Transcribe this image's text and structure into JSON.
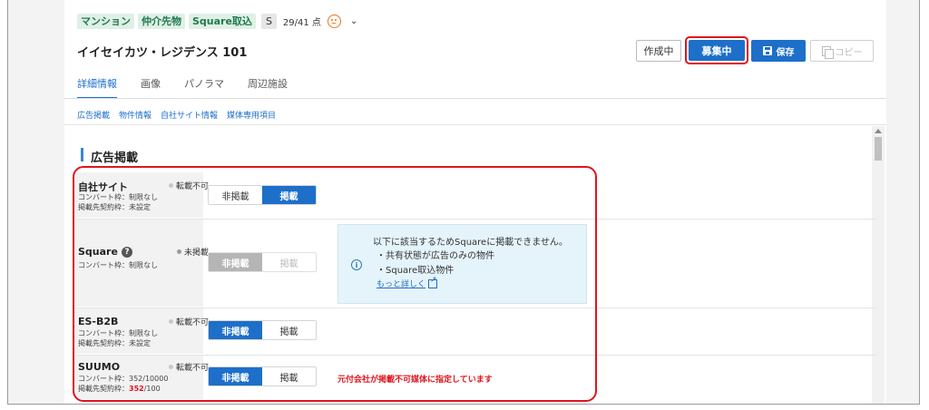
{
  "header": {
    "tags": [
      "マンション",
      "仲介先物",
      "Square取込"
    ],
    "tag_s": "S",
    "score": "29/41 点",
    "title": "イイセイカツ・レジデンス 101"
  },
  "actions": {
    "draft": "作成中",
    "recruiting": "募集中",
    "save": "保存",
    "copy": "コピー"
  },
  "tabs": [
    "詳細情報",
    "画像",
    "パノラマ",
    "周辺施設"
  ],
  "subnav": [
    "広告掲載",
    "物件情報",
    "自社サイト情報",
    "媒体専用項目"
  ],
  "section": {
    "title": "広告掲載"
  },
  "media": [
    {
      "name": "自社サイト",
      "status": "転載不可",
      "line1": "コンバート枠：制限なし",
      "line2": "掲載先契約枠：未設定",
      "off": "非掲載",
      "on": "掲載"
    },
    {
      "name": "Square",
      "status": "未掲載",
      "line1": "コンバート枠：制限なし",
      "off": "非掲載",
      "on": "掲載"
    },
    {
      "name": "ES-B2B",
      "status": "転載不可",
      "line1": "コンバート枠：制限なし",
      "line2": "掲載先契約枠：未設定",
      "off": "非掲載",
      "on": "掲載"
    },
    {
      "name": "SUUMO",
      "status": "転載不可",
      "line1": "コンバート枠：352/10000",
      "line2_prefix": "掲載先契約枠：",
      "line2_red": "352",
      "line2_suffix": "/100",
      "off": "非掲載",
      "on": "掲載"
    }
  ],
  "info": {
    "title": "以下に該当するためSquareに掲載できません。",
    "bullet1": "・共有状態が広告のみの物件",
    "bullet2": "・Square取込物件",
    "link": "もっと詳しく",
    "icon": "i"
  },
  "warning": "元付会社が掲載不可媒体に指定しています"
}
